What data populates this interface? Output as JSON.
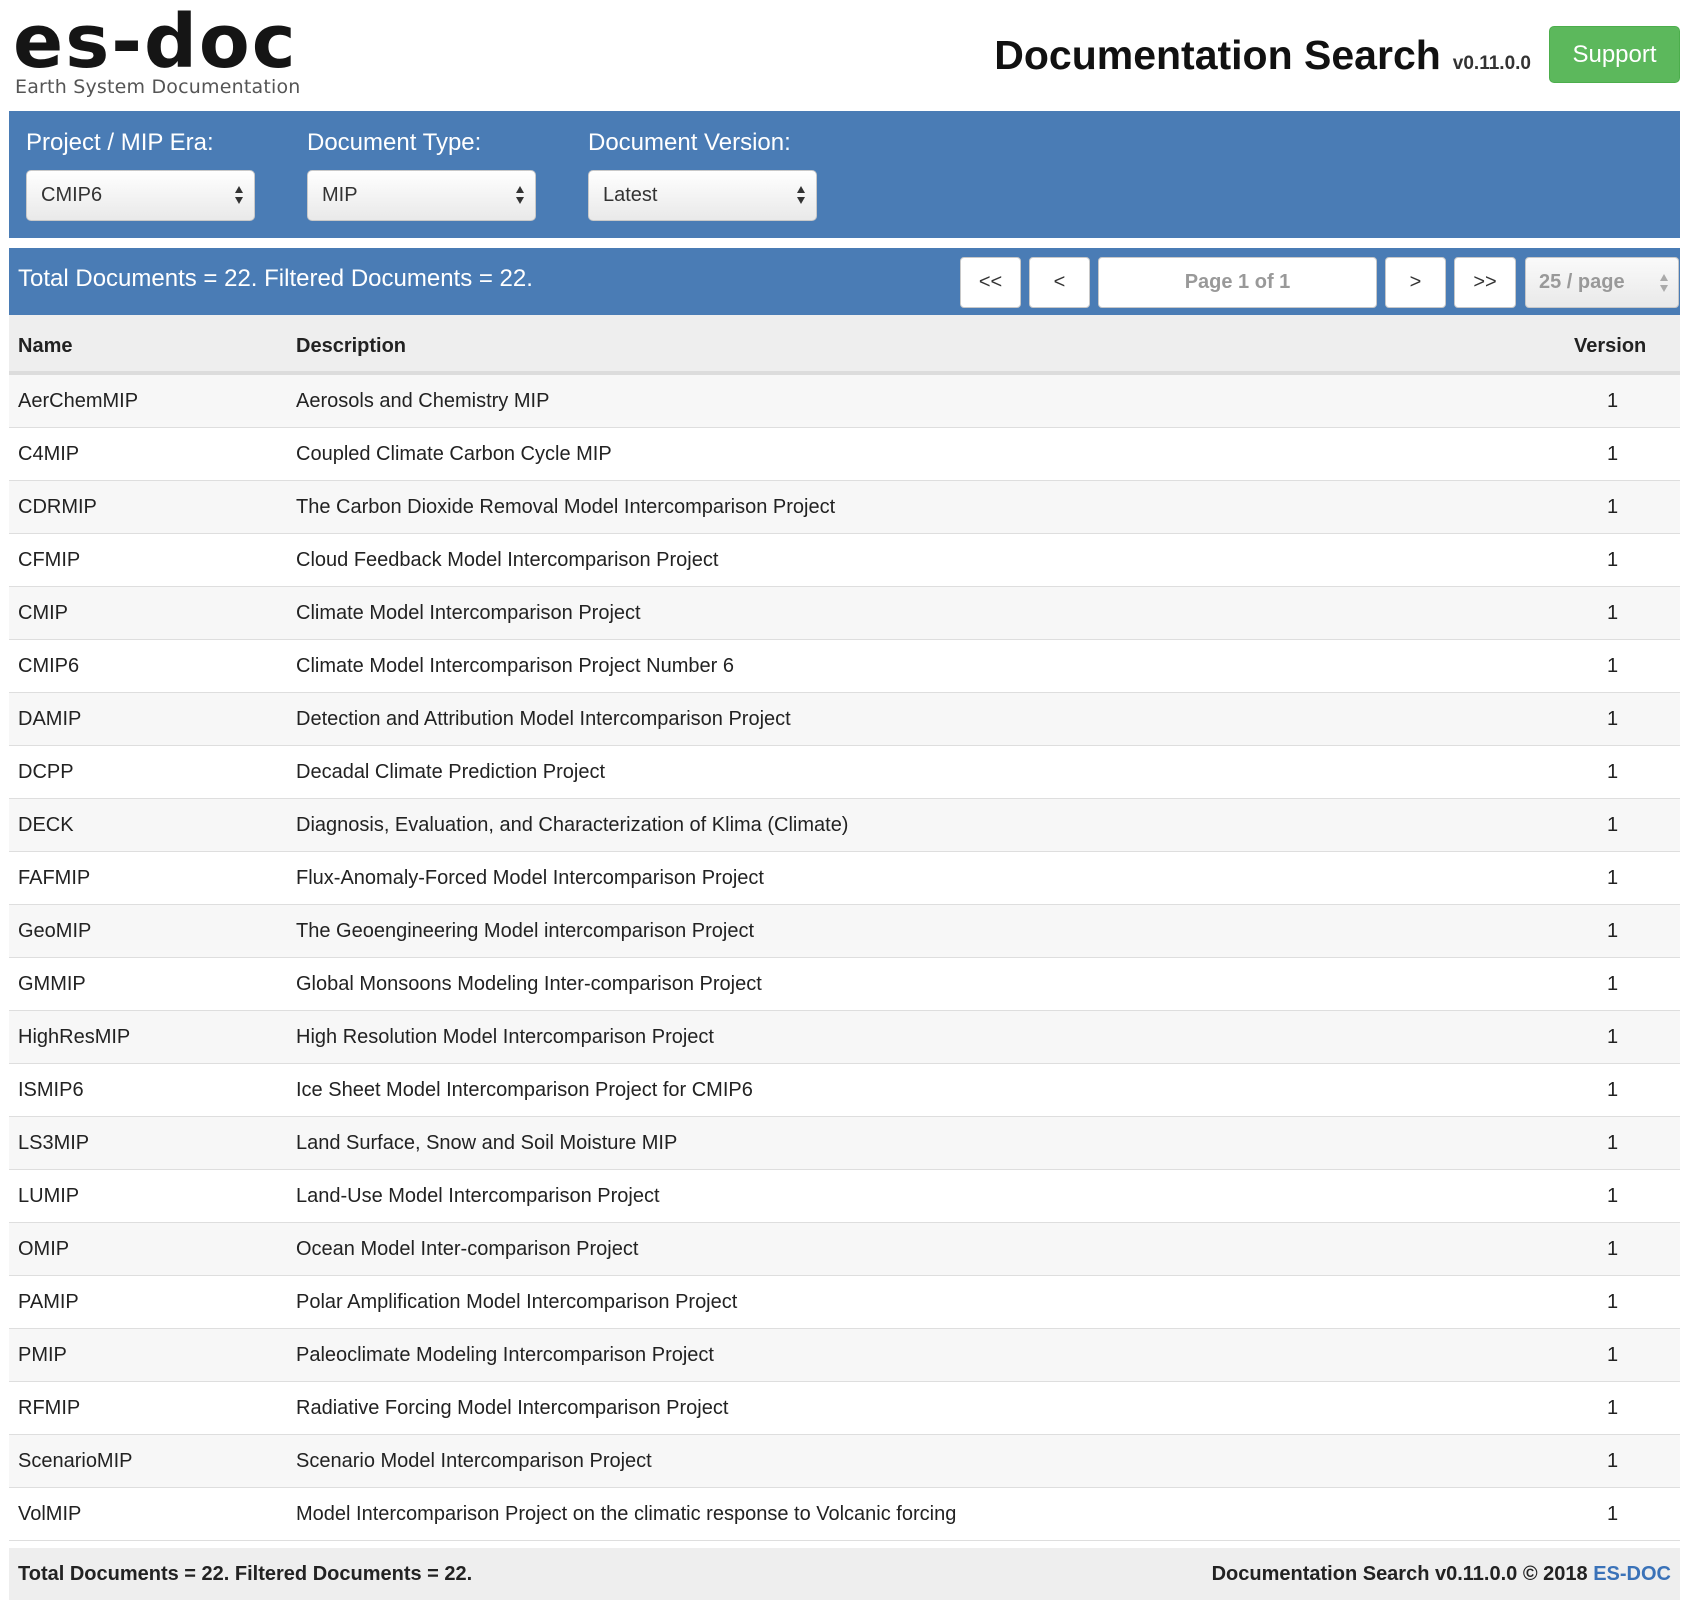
{
  "header": {
    "logo_text": "es-doc",
    "logo_subtitle": "Earth System Documentation",
    "title": "Documentation Search",
    "version": "v0.11.0.0",
    "support_label": "Support"
  },
  "filters": {
    "project": {
      "label": "Project / MIP Era:",
      "value": "CMIP6"
    },
    "doc_type": {
      "label": "Document Type:",
      "value": "MIP"
    },
    "doc_version": {
      "label": "Document Version:",
      "value": "Latest"
    }
  },
  "pager": {
    "summary": "Total Documents = 22. Filtered Documents = 22.",
    "first_label": "<<",
    "prev_label": "<",
    "page_info": "Page 1 of 1",
    "next_label": ">",
    "last_label": ">>",
    "per_page": "25 / page"
  },
  "table": {
    "columns": {
      "name": "Name",
      "description": "Description",
      "version": "Version"
    },
    "rows": [
      {
        "name": "AerChemMIP",
        "description": "Aerosols and Chemistry MIP",
        "version": "1"
      },
      {
        "name": "C4MIP",
        "description": "Coupled Climate Carbon Cycle MIP",
        "version": "1"
      },
      {
        "name": "CDRMIP",
        "description": "The Carbon Dioxide Removal Model Intercomparison Project",
        "version": "1"
      },
      {
        "name": "CFMIP",
        "description": "Cloud Feedback Model Intercomparison Project",
        "version": "1"
      },
      {
        "name": "CMIP",
        "description": "Climate Model Intercomparison Project",
        "version": "1"
      },
      {
        "name": "CMIP6",
        "description": "Climate Model Intercomparison Project Number 6",
        "version": "1"
      },
      {
        "name": "DAMIP",
        "description": "Detection and Attribution Model Intercomparison Project",
        "version": "1"
      },
      {
        "name": "DCPP",
        "description": "Decadal Climate Prediction Project",
        "version": "1"
      },
      {
        "name": "DECK",
        "description": "Diagnosis, Evaluation, and Characterization of Klima (Climate)",
        "version": "1"
      },
      {
        "name": "FAFMIP",
        "description": "Flux-Anomaly-Forced Model Intercomparison Project",
        "version": "1"
      },
      {
        "name": "GeoMIP",
        "description": "The Geoengineering Model intercomparison Project",
        "version": "1"
      },
      {
        "name": "GMMIP",
        "description": "Global Monsoons Modeling Inter-comparison Project",
        "version": "1"
      },
      {
        "name": "HighResMIP",
        "description": "High Resolution Model Intercomparison Project",
        "version": "1"
      },
      {
        "name": "ISMIP6",
        "description": "Ice Sheet Model Intercomparison Project for CMIP6",
        "version": "1"
      },
      {
        "name": "LS3MIP",
        "description": "Land Surface, Snow and Soil Moisture MIP",
        "version": "1"
      },
      {
        "name": "LUMIP",
        "description": "Land-Use Model Intercomparison Project",
        "version": "1"
      },
      {
        "name": "OMIP",
        "description": "Ocean Model Inter-comparison Project",
        "version": "1"
      },
      {
        "name": "PAMIP",
        "description": "Polar Amplification Model Intercomparison Project",
        "version": "1"
      },
      {
        "name": "PMIP",
        "description": "Paleoclimate Modeling Intercomparison Project",
        "version": "1"
      },
      {
        "name": "RFMIP",
        "description": "Radiative Forcing Model Intercomparison Project",
        "version": "1"
      },
      {
        "name": "ScenarioMIP",
        "description": "Scenario Model Intercomparison Project",
        "version": "1"
      },
      {
        "name": "VolMIP",
        "description": "Model Intercomparison Project on the climatic response to Volcanic forcing",
        "version": "1"
      }
    ]
  },
  "footer": {
    "summary": "Total Documents = 22. Filtered Documents = 22.",
    "credit": "Documentation Search v0.11.0.0 © 2018",
    "link_label": "ES-DOC"
  },
  "colors": {
    "panel_blue": "#4a7cb5",
    "support_green": "#5cb85c",
    "link_blue": "#3a72b8"
  }
}
